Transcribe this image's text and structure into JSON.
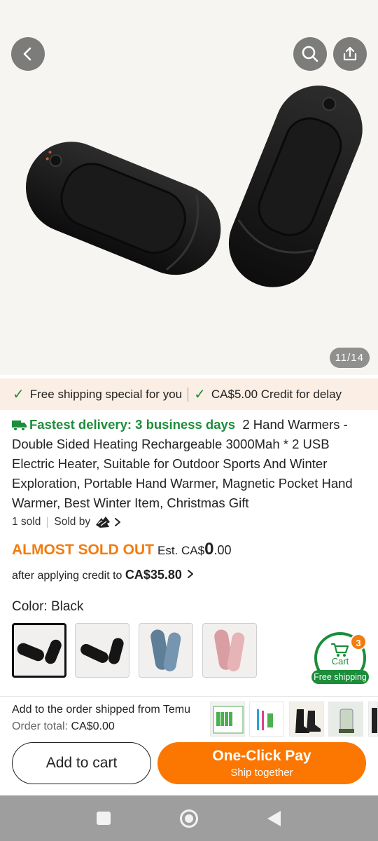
{
  "gallery": {
    "counter": "11/14",
    "back_icon": "chevron-left-icon",
    "search_icon": "search-icon",
    "share_icon": "share-icon"
  },
  "promo": {
    "free_shipping": "Free shipping special for you",
    "credit_delay": "CA$5.00 Credit for delay"
  },
  "product": {
    "fastest_delivery": "Fastest delivery: 3 business days",
    "title": "2 Hand Warmers - Double Sided Heating Rechargeable 3000Mah * 2 USB Electric Heater, Suitable for Outdoor Sports And Winter Exploration, Portable Hand Warmer, Magnetic Pocket Hand Warmer, Best Winter Item, Christmas Gift",
    "sold": "1 sold",
    "sold_by": "Sold by"
  },
  "price": {
    "almost_sold_out": "ALMOST SOLD OUT",
    "est_prefix": "Est. CA$",
    "est_whole": "0",
    "est_decimal": ".00",
    "after_credit_text": "after applying credit to",
    "after_credit_amount": "CA$35.80"
  },
  "color": {
    "label": "Color: Black",
    "options": [
      "Black",
      "Black",
      "Blue",
      "Pink"
    ]
  },
  "cart_badge": {
    "label": "Cart",
    "count": "3",
    "free_shipping": "Free shipping"
  },
  "bottom_bar": {
    "add_to_order": "Add to the order shipped from Temu",
    "order_total_label": "Order total:",
    "order_total_value": "CA$0.00",
    "add_to_cart": "Add to cart",
    "one_click_pay": "One-Click Pay",
    "ship_together": "Ship together"
  },
  "colors": {
    "accent_orange": "#fb7701",
    "green": "#1c8d3a",
    "promo_bg": "#fbeee4"
  }
}
